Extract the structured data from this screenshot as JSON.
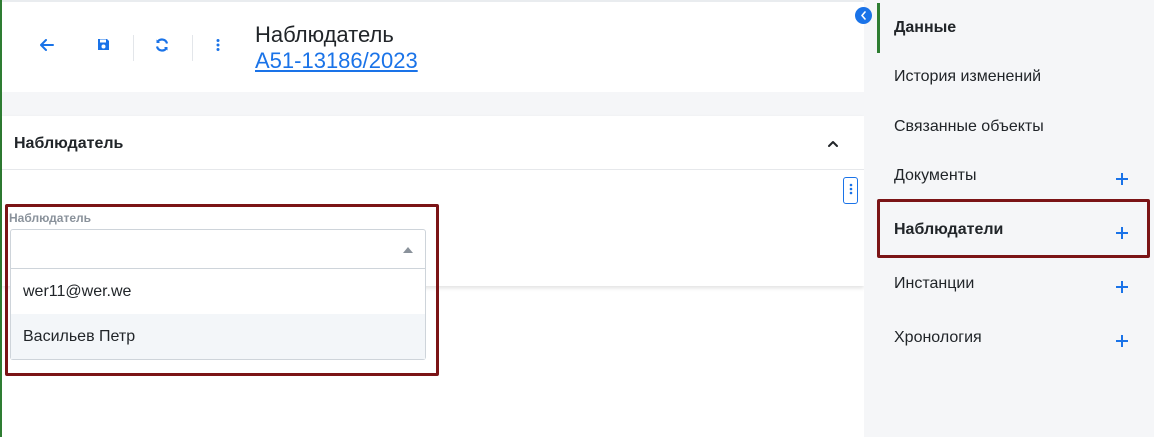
{
  "header": {
    "title": "Наблюдатель",
    "case_number": "А51-13186/2023",
    "toolbar": {
      "back_icon": "arrow-left-icon",
      "save_icon": "floppy-disk-icon",
      "refresh_icon": "refresh-icon",
      "more_icon": "kebab-menu-icon"
    }
  },
  "card": {
    "title": "Наблюдатель",
    "field": {
      "label": "Наблюдатель",
      "value": "",
      "options": [
        "wer11@wer.we",
        "Васильев Петр"
      ],
      "highlighted_option": "Васильев Петр"
    }
  },
  "sidebar": {
    "items": [
      {
        "label": "Данные",
        "active": true,
        "has_add": false
      },
      {
        "label": "История изменений",
        "active": false,
        "has_add": false
      },
      {
        "label": "Связанные объекты",
        "active": false,
        "has_add": false
      },
      {
        "label": "Документы",
        "active": false,
        "has_add": true
      },
      {
        "label": "Наблюдатели",
        "active": false,
        "has_add": true
      },
      {
        "label": "Инстанции",
        "active": false,
        "has_add": true
      },
      {
        "label": "Хронология",
        "active": false,
        "has_add": true
      }
    ]
  },
  "colors": {
    "accent": "#1a73e8",
    "active_marker": "#2e7d32",
    "highlight_frame": "#7b1416",
    "sidebar_bg": "#f5f6f8"
  }
}
